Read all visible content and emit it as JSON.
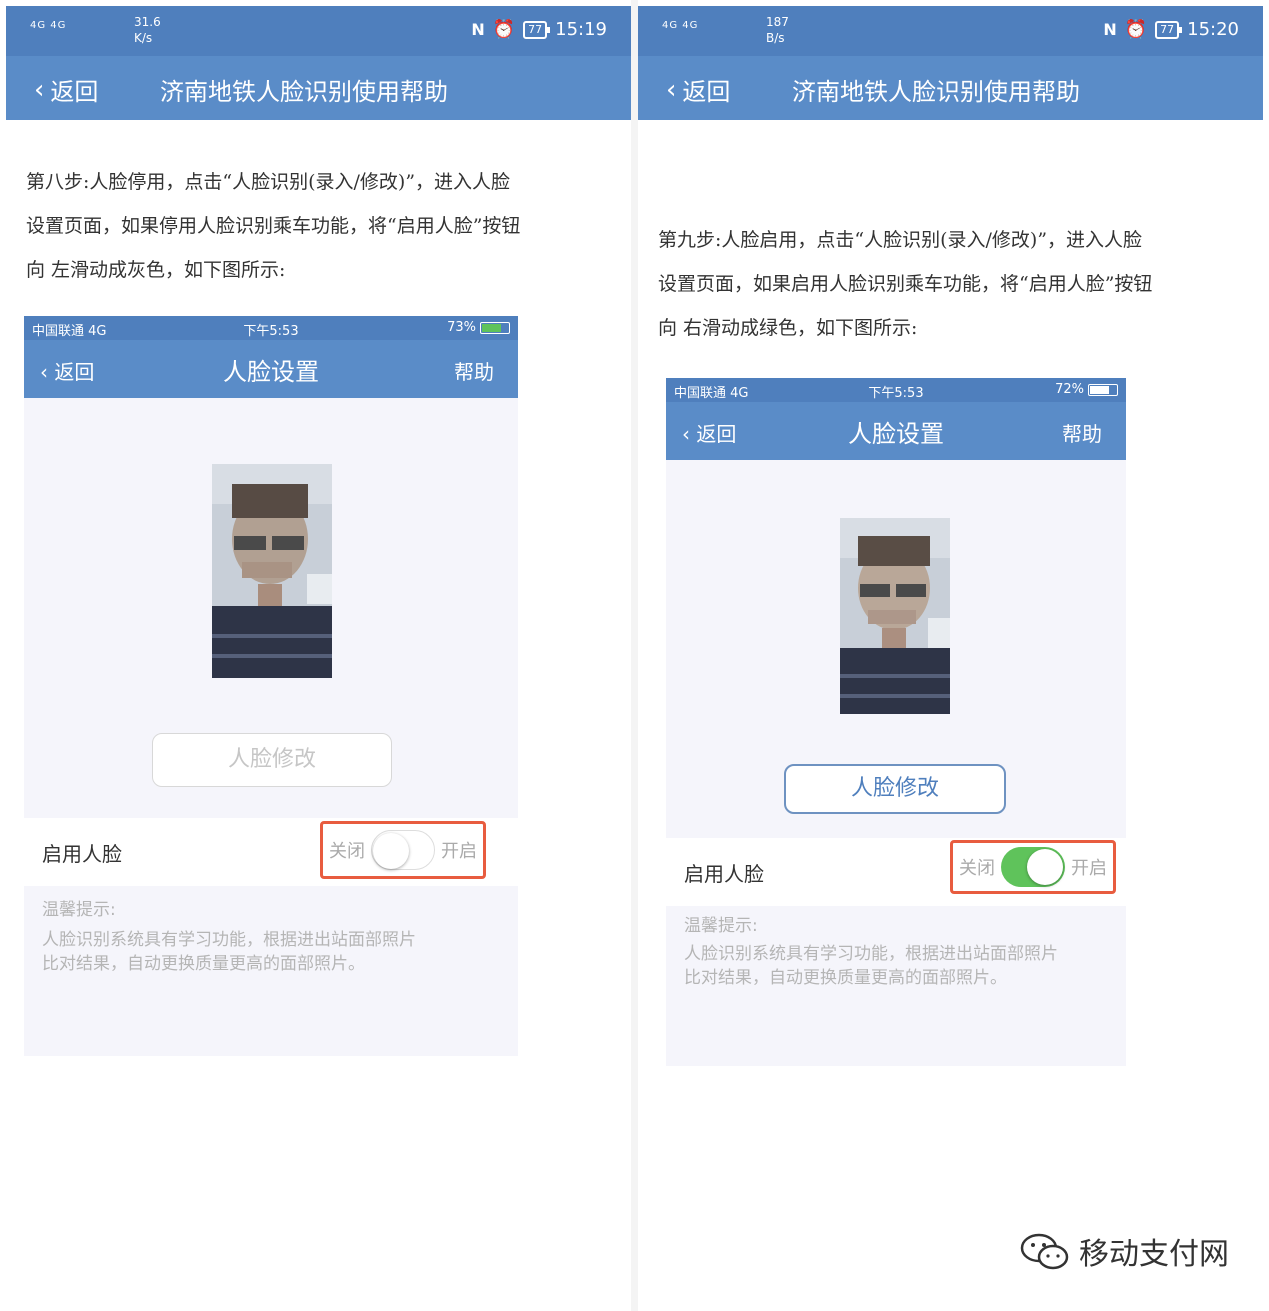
{
  "colors": {
    "status_bar": "#4f7fbd",
    "nav_bar": "#5a8cc8",
    "highlight_box": "#e85c3f",
    "switch_on": "#5fc35b"
  },
  "left": {
    "status": {
      "signal": "4G 4G",
      "speed_value": "31.6",
      "speed_unit": "K/s",
      "battery": "77",
      "time": "15:19"
    },
    "nav": {
      "back": "返回",
      "title": "济南地铁人脸识别使用帮助"
    },
    "article": [
      "第八步:人脸停用，点击“人脸识别(录入/修改)”，进入人脸",
      "设置页面，如果停用人脸识别乘车功能，将“启用人脸”按钮",
      "向  左滑动成灰色，如下图所示:"
    ],
    "phone": {
      "carrier": "中国联通  4G",
      "time": "下午5:53",
      "battery": "73%",
      "battery_level": 0.73,
      "back": "返回",
      "title": "人脸设置",
      "help": "帮助",
      "edit_button": "人脸修改",
      "toggle_label": "启用人脸",
      "toggle_off": "关闭",
      "toggle_on": "开启",
      "toggle_state": "off",
      "tips_title": "温馨提示:",
      "tips_line1": "人脸识别系统具有学习功能，根据进出站面部照片",
      "tips_line2": "比对结果，自动更换质量更高的面部照片。"
    }
  },
  "right": {
    "status": {
      "signal": "4G 4G",
      "speed_value": "187",
      "speed_unit": "B/s",
      "battery": "77",
      "time": "15:20"
    },
    "nav": {
      "back": "返回",
      "title": "济南地铁人脸识别使用帮助"
    },
    "article": [
      "第九步:人脸启用，点击“人脸识别(录入/修改)”，进入人脸",
      "设置页面，如果启用人脸识别乘车功能，将“启用人脸”按钮",
      "向  右滑动成绿色，如下图所示:"
    ],
    "phone": {
      "carrier": "中国联通  4G",
      "time": "下午5:53",
      "battery": "72%",
      "battery_level": 0.72,
      "back": "返回",
      "title": "人脸设置",
      "help": "帮助",
      "edit_button": "人脸修改",
      "toggle_label": "启用人脸",
      "toggle_off": "关闭",
      "toggle_on": "开启",
      "toggle_state": "on",
      "tips_title": "温馨提示:",
      "tips_line1": "人脸识别系统具有学习功能，根据进出站面部照片",
      "tips_line2": "比对结果，自动更换质量更高的面部照片。"
    }
  },
  "watermark": {
    "text": "移动支付网",
    "icon": "wechat-icon"
  }
}
